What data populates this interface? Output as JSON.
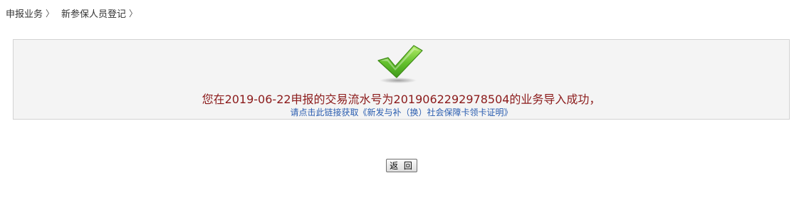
{
  "breadcrumb": {
    "items": [
      {
        "label": "申报业务"
      },
      {
        "label": "新参保人员登记"
      }
    ],
    "separator": "〉"
  },
  "result": {
    "icon": "check-icon",
    "message": "您在2019-06-22申报的交易流水号为2019062292978504的业务导入成功，",
    "link_text": "请点击此链接获取《新发与补（换）社会保障卡领卡证明》"
  },
  "actions": {
    "return_label": "返 回"
  },
  "colors": {
    "message": "#8b1a1a",
    "link": "#2a5db0",
    "check": "#5cb82a",
    "panel_bg": "#f4f4f4",
    "panel_border": "#d3d3d3"
  }
}
